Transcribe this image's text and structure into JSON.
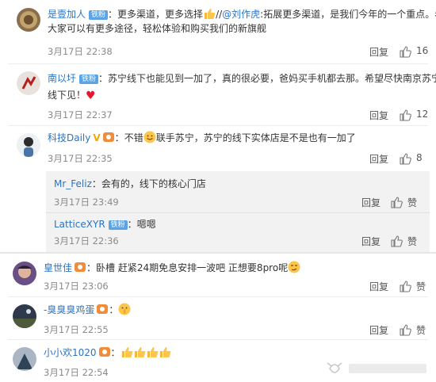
{
  "badges": {
    "vip": "铁粉"
  },
  "actions": {
    "reply": "回复",
    "like": "赞"
  },
  "colors": {
    "username": "#2b74c4",
    "time": "#8a8a8a",
    "vip_badge": "#5aa4e6",
    "heart": "#e5162d"
  },
  "comments": [
    {
      "user": "是壹加人",
      "separator": "：",
      "text_a": "更多渠道，更多选择",
      "text_b": "//",
      "mention": "@刘作虎",
      "text_c": ":拓展更多渠道，是我们今年的一个重点。希望",
      "line2": "大家可以有更多途径，轻松体验和购买我们的新旗舰",
      "time": "3月17日 22:38",
      "likes": "16",
      "avatar_icon": "profile-avatar",
      "emoji": "thumbs-up-emoji"
    },
    {
      "user": "南以圩",
      "separator": "：",
      "text": "苏宁线下也能见到一加了，真的很必要，爸妈买手机都去那。希望尽快南京苏宁",
      "line2": "线下见！",
      "time": "3月17日 22:37",
      "likes": "12",
      "emoji": "red-heart-emoji"
    },
    {
      "user": "科技Daily",
      "separator": "：",
      "text_a": "不错",
      "text_b": "联手苏宁，苏宁的线下实体店是不是也有一加了",
      "time": "3月17日 22:35",
      "likes": "8",
      "emoji": "grin-emoji"
    }
  ],
  "replies": [
    {
      "user": "Mr_Feliz",
      "separator": "：",
      "text": "会有的，线下的核心门店",
      "time": "3月17日 23:49"
    },
    {
      "user": "LatticeXYR",
      "separator": "：",
      "text": "嗯嗯",
      "time": "3月17日 22:36"
    }
  ],
  "comments2": [
    {
      "user": "皇世佳",
      "separator": "：",
      "text": "卧槽 赶紧24期免息安排一波吧 正想要8pro呢",
      "time": "3月17日 23:06",
      "emoji": "smirk-emoji"
    },
    {
      "user": "-臭臭臭鸡蛋",
      "separator": "：",
      "text": "",
      "time": "3月17日 22:55",
      "emoji": "shush-emoji"
    },
    {
      "user": "小小欢1020",
      "separator": "：",
      "text": "",
      "time": "3月17日 22:54",
      "emoji": "thumbs-up-emoji"
    }
  ]
}
